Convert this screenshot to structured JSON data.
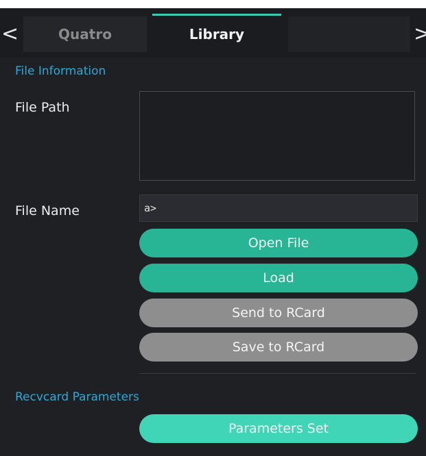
{
  "tabs": {
    "prev_arrow": "<",
    "next_arrow": ">",
    "items": [
      {
        "label": "Quatro",
        "active": false
      },
      {
        "label": "Library",
        "active": true
      },
      {
        "label": "",
        "active": false
      }
    ]
  },
  "file_information": {
    "section_title": "File Information",
    "file_path_label": "File Path",
    "file_path_value": "",
    "file_name_label": "File Name",
    "file_name_value": "a>"
  },
  "buttons": {
    "open_file": "Open File",
    "load": "Load",
    "send_to_rcard": "Send to RCard",
    "save_to_rcard": "Save to RCard"
  },
  "recvcard": {
    "section_title": "Recvcard Parameters",
    "parameters_set": "Parameters Set"
  },
  "colors": {
    "accent_teal": "#27b596",
    "accent_mint": "#41d5b8",
    "disabled_grey": "#8e8e8e",
    "section_blue": "#2fa7d6",
    "panel_bg": "#1f2023"
  }
}
